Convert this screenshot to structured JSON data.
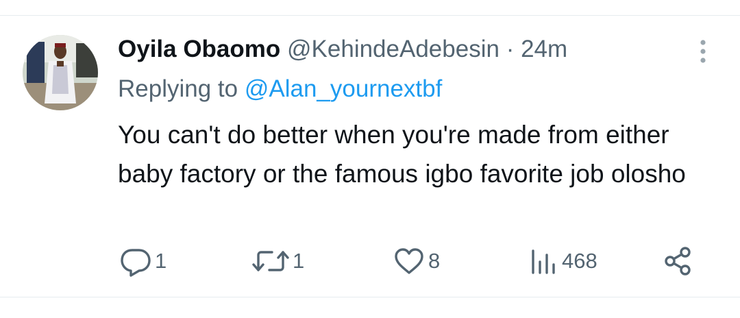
{
  "tweet": {
    "author_name": "Oyila Obaomo",
    "author_handle": "@KehindeAdebesin",
    "separator": "·",
    "time": "24m",
    "replying_prefix": "Replying to",
    "reply_to_handle": "@Alan_yournextbf",
    "text": "You can't do better when you're made from either baby factory or the famous igbo favorite job olosho"
  },
  "actions": {
    "replies": "1",
    "retweets": "1",
    "likes": "8",
    "views": "468"
  },
  "icons": {
    "avatar": "avatar-photo",
    "more": "more-vertical-icon",
    "reply": "reply-icon",
    "retweet": "retweet-icon",
    "like": "heart-icon",
    "views": "views-icon",
    "share": "share-icon"
  },
  "colors": {
    "text": "#0f1419",
    "secondary": "#536471",
    "accent": "#1d9bf0",
    "divider": "#e6ecef"
  }
}
